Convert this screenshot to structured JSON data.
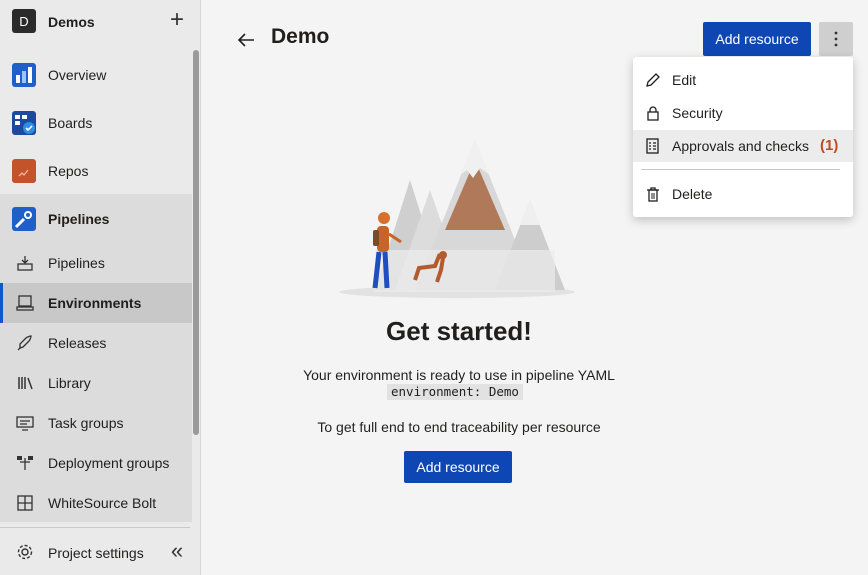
{
  "project": {
    "avatar_letter": "D",
    "name": "Demos",
    "add_icon": "plus-icon"
  },
  "nav": [
    {
      "label": "Overview",
      "icon": "overview-icon"
    },
    {
      "label": "Boards",
      "icon": "boards-icon"
    },
    {
      "label": "Repos",
      "icon": "repos-icon"
    },
    {
      "label": "Pipelines",
      "icon": "pipelines-icon"
    }
  ],
  "sub_nav": [
    {
      "label": "Pipelines",
      "icon": "pipeline-sub-icon"
    },
    {
      "label": "Environments",
      "icon": "environments-icon"
    },
    {
      "label": "Releases",
      "icon": "releases-icon"
    },
    {
      "label": "Library",
      "icon": "library-icon"
    },
    {
      "label": "Task groups",
      "icon": "task-groups-icon"
    },
    {
      "label": "Deployment groups",
      "icon": "deployment-groups-icon"
    },
    {
      "label": "WhiteSource Bolt",
      "icon": "whitesource-icon"
    }
  ],
  "footer": {
    "settings_label": "Project settings",
    "collapse_icon": "double-chevron-left-icon"
  },
  "header": {
    "title": "Demo",
    "add_resource_label": "Add resource"
  },
  "empty_state": {
    "heading": "Get started!",
    "ready_text": "Your environment is ready to use in pipeline YAML",
    "yaml_code": "environment: Demo",
    "trace_text": "To get full end to end traceability per resource",
    "add_resource_label": "Add resource"
  },
  "menu": {
    "items": [
      {
        "label": "Edit",
        "icon": "pencil-icon"
      },
      {
        "label": "Security",
        "icon": "lock-icon"
      },
      {
        "label": "Approvals and checks",
        "icon": "checklist-icon",
        "badge": "(1)"
      },
      {
        "label": "Delete",
        "icon": "trash-icon"
      }
    ]
  },
  "colors": {
    "accent": "#0e47b4",
    "badge": "#c04b22",
    "selection_bar": "#0f58c8"
  }
}
